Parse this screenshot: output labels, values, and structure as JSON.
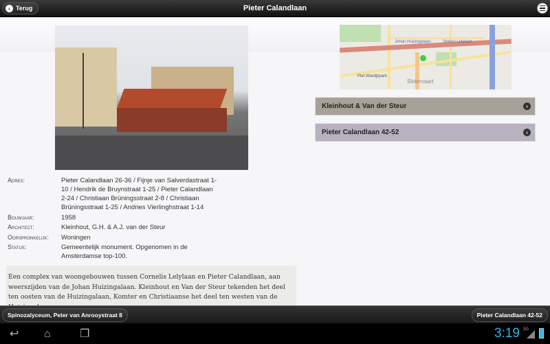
{
  "header": {
    "back_label": "Terug",
    "title": "Pieter Calandlaan"
  },
  "links": [
    {
      "label": "Kleinhout & Van der Steur",
      "color": "#a8a199"
    },
    {
      "label": "Pieter Calandlaan 42-52",
      "color": "#b7b1c0"
    }
  ],
  "map": {
    "labels": [
      "Piet Wiedijkpark",
      "Slotervaart",
      "Johan Huizingalaan",
      "Station Lelylaan"
    ]
  },
  "details": [
    {
      "key": "Adres:",
      "value": "Pieter Calandlaan 26-36 / Fijnje van Salverdastraat 1-10 / Hendrik de Bruynstraat 1-25 / Pieter Calandlaan 2-24 / Christiaan Brüningsstraat 2-8 / Christiaan Brüningsstraat 1-25 / Andries Vierlinghstraat 1-14"
    },
    {
      "key": "Bouwjaar:",
      "value": "1958"
    },
    {
      "key": "Architect:",
      "value": "Kleinhout, G.H. & A.J. van der Steur"
    },
    {
      "key": "Oorspronkelijk:",
      "value": "Woningen"
    },
    {
      "key": "Status:",
      "value": "Gemeentelijk monument. Opgenomen in de Amsterdamse top-100."
    }
  ],
  "description": "Een complex van woongebouwen tussen Cornelis Lelylaan en Pieter Calandlaan, aan weerszijden van de Johan Huizingalaan. Kleinhout en Van der Steur tekenden het deel ten oosten van de Huizingalaan, Komter en Christiaanse het deel ten westen van de Huizingalaan.",
  "footer": {
    "prev_label": "Spinozalyceum, Peter van Anrooystraat 8",
    "next_label": "Pieter Calandlaan 42-52"
  },
  "status_bar": {
    "time": "3:19",
    "network": "3G"
  }
}
